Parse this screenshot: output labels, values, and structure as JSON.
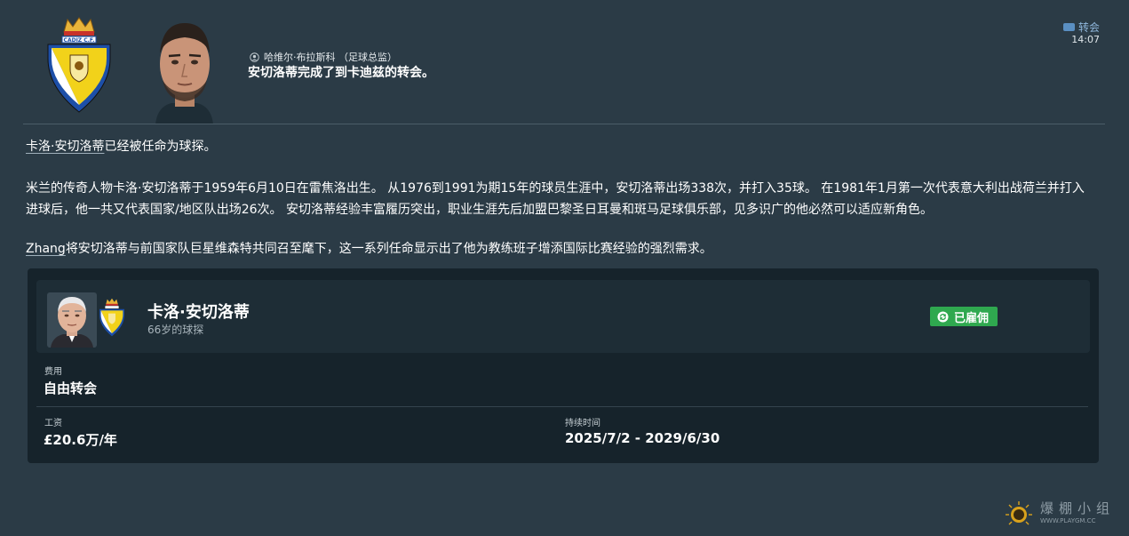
{
  "header": {
    "sender_name": "哈维尔·布拉斯科 （足球总监）",
    "headline": "安切洛蒂完成了到卡迪兹的转会。",
    "type_label": "转会",
    "time": "14:07",
    "crest_text": "CADIZ C.F."
  },
  "body": {
    "p1_name_link": "卡洛·安切洛蒂",
    "p1_rest": "已经被任命为球探。",
    "p2": "米兰的传奇人物卡洛·安切洛蒂于1959年6月10日在雷焦洛出生。 从1976到1991为期15年的球员生涯中，安切洛蒂出场338次，并打入35球。 在1981年1月第一次代表意大利出战荷兰并打入进球后，他一共又代表国家/地区队出场26次。 安切洛蒂经验丰富履历突出，职业生涯先后加盟巴黎圣日耳曼和斑马足球俱乐部，见多识广的他必然可以适应新角色。",
    "p3_name_link": "Zhang",
    "p3_rest": "将安切洛蒂与前国家队巨星维森特共同召至麾下，这一系列任命显示出了他为教练班子增添国际比赛经验的强烈需求。"
  },
  "card": {
    "staff_name": "卡洛·安切洛蒂",
    "staff_sub": "66岁的球探",
    "status_label": "已雇佣",
    "fee_label": "费用",
    "fee_value": "自由转会",
    "wage_label": "工资",
    "wage_value": "£20.6万/年",
    "duration_label": "持续时间",
    "duration_value": "2025/7/2 - 2029/6/30"
  },
  "watermark": {
    "text": "爆棚小组",
    "url": "WWW.PLAYGM.CC"
  },
  "colors": {
    "background": "#2b3b46",
    "card": "#16232b",
    "card_row": "#1e2d36",
    "status_green": "#2fa84f",
    "accent_blue": "#5a8fc2",
    "crest_yellow": "#f2d21a",
    "crest_blue": "#1d4fa8"
  }
}
